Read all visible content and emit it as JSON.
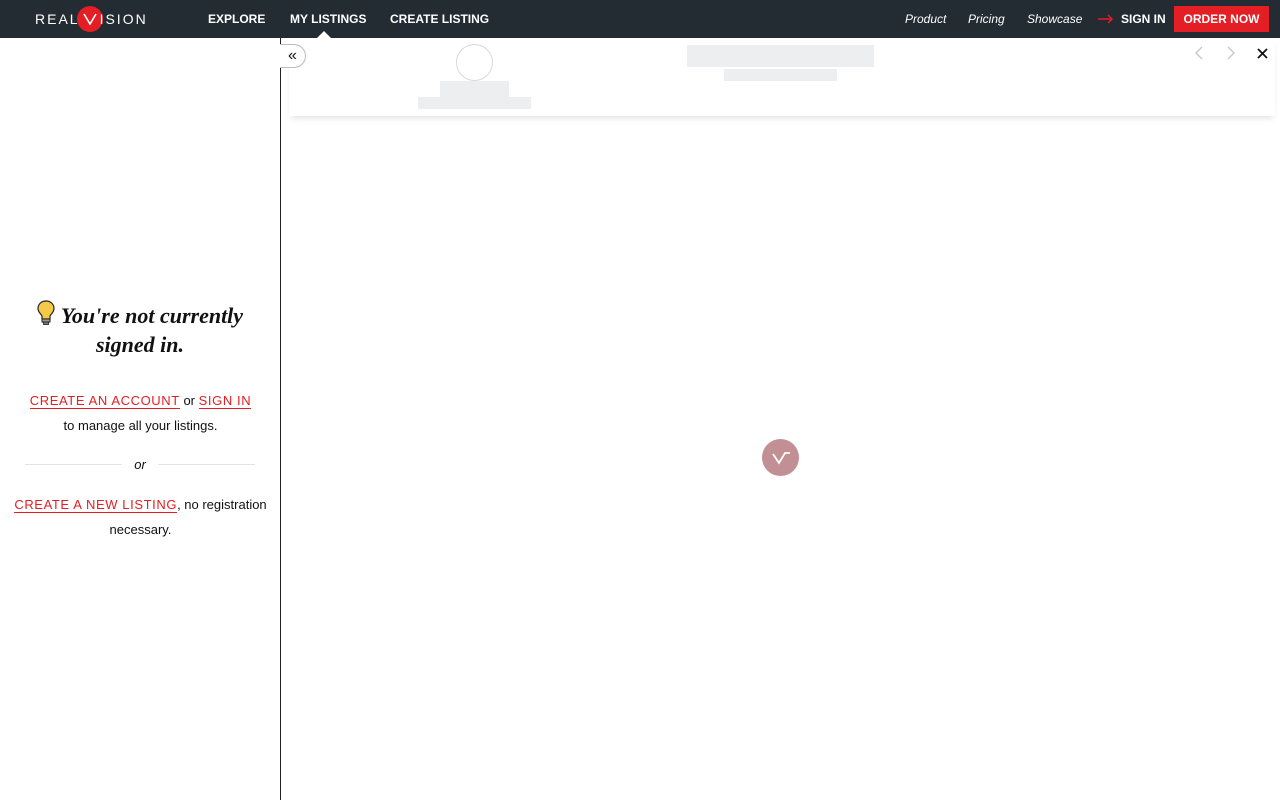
{
  "brand": {
    "left_text": "REAL",
    "right_text": "ISION",
    "accent_color": "#e31e24",
    "nav_bg": "#232b33"
  },
  "nav": {
    "explore": "EXPLORE",
    "my_listings": "MY LISTINGS",
    "create_listing": "CREATE LISTING",
    "product": "Product",
    "pricing": "Pricing",
    "showcase": "Showcase",
    "sign_in": "SIGN IN",
    "order_now": "ORDER NOW"
  },
  "sidebar": {
    "title": "You're not currently signed in.",
    "create_account": "CREATE AN ACCOUNT",
    "or_word": "or",
    "sign_in": "SIGN IN",
    "manage_text": "to manage all your listings.",
    "divider_or": "or",
    "create_new_listing": "CREATE A NEW LISTING",
    "no_registration": ", no registration",
    "necessary": "necessary."
  },
  "icons": {
    "collapse": "double-chevron-left-icon",
    "prev": "chevron-left-icon",
    "next": "chevron-right-icon",
    "close": "close-icon",
    "loader": "realvision-loader-icon",
    "bulb": "lightbulb-icon",
    "signin_arrow": "arrow-right-icon"
  }
}
